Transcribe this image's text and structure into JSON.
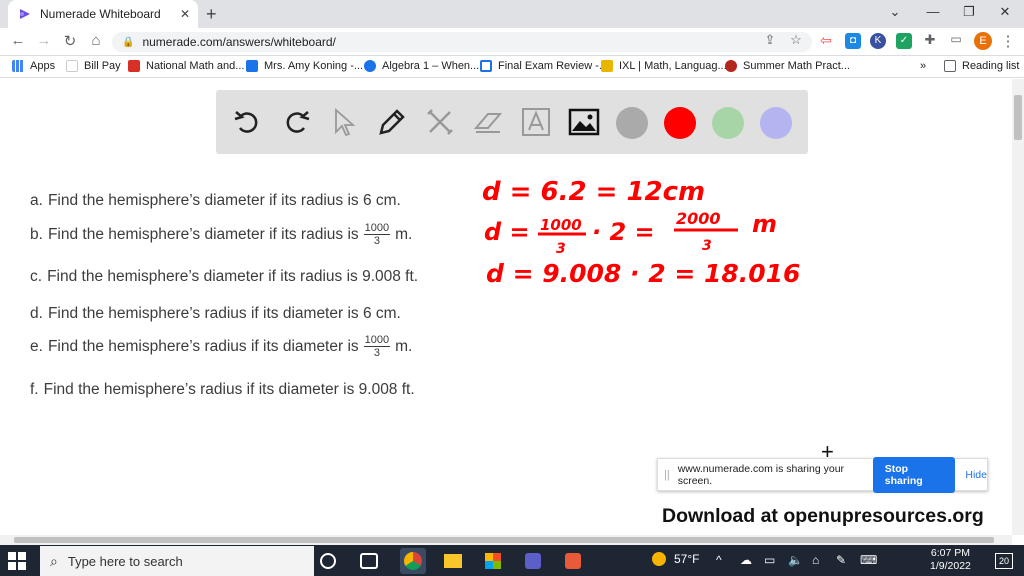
{
  "browser": {
    "tab_title": "Numerade Whiteboard",
    "url": "numerade.com/answers/whiteboard/",
    "profile_initial": "E"
  },
  "bookmarks": [
    {
      "label": "Apps",
      "icon": "apps-grid-icon",
      "color": "#4285f4"
    },
    {
      "label": "Bill Pay",
      "icon": "blank-page-icon",
      "color": "#ffffff"
    },
    {
      "label": "National Math and...",
      "icon": "nmsi-icon",
      "color": "#d93025"
    },
    {
      "label": "Mrs. Amy Koning -...",
      "icon": "calendar-icon",
      "color": "#1a73e8"
    },
    {
      "label": "Algebra 1 – When...",
      "icon": "wordpress-icon",
      "color": "#1a73e8"
    },
    {
      "label": "Final Exam Review -...",
      "icon": "doc-icon",
      "color": "#1a73e8"
    },
    {
      "label": "IXL | Math, Languag...",
      "icon": "ixl-icon",
      "color": "#e8b600"
    },
    {
      "label": "Summer Math Pract...",
      "icon": "globe-icon",
      "color": "#b3261e"
    }
  ],
  "reading_list_label": "Reading list",
  "whiteboard": {
    "colors": [
      "#aaaaaa",
      "#ff0000",
      "#a8d5a8",
      "#b4b4f0"
    ]
  },
  "problems": [
    {
      "letter": "a.",
      "pre": "Find the hemisphere’s diameter if its radius is 6 cm."
    },
    {
      "letter": "b.",
      "pre": "Find the hemisphere’s diameter if its radius is",
      "num": "1000",
      "den": "3",
      "post": "m."
    },
    {
      "letter": "c.",
      "pre": "Find the hemisphere’s diameter if its radius is 9.008 ft."
    },
    {
      "letter": "d.",
      "pre": "Find the hemisphere’s radius if its diameter is 6 cm."
    },
    {
      "letter": "e.",
      "pre": "Find the hemisphere’s radius if its diameter is",
      "num": "1000",
      "den": "3",
      "post": "m."
    },
    {
      "letter": "f.",
      "pre": "Find the hemisphere’s radius if its diameter is 9.008 ft."
    }
  ],
  "handwriting": {
    "line1": "d = 6.2 = 12cm",
    "line2_a": "d =",
    "line2_num": "1000",
    "line2_den": "3",
    "line2_b": "· 2 =",
    "line2_num2": "2000",
    "line2_den2": "3",
    "line2_unit": "m",
    "line3": "d = 9.008 · 2 = 18.016",
    "color": "#ff0000"
  },
  "share_bar": {
    "message": "www.numerade.com is sharing your screen.",
    "stop_label": "Stop sharing",
    "hide_label": "Hide"
  },
  "watermark": "Download at openupresources.org",
  "taskbar": {
    "search_placeholder": "Type here to search",
    "temperature": "57°F",
    "time": "6:07 PM",
    "date": "1/9/2022",
    "notifications": "20"
  }
}
